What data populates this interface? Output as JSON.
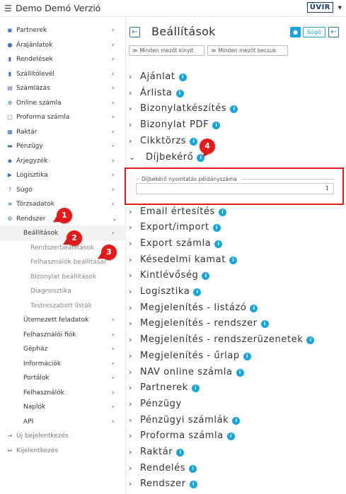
{
  "header": {
    "menu_icon": "hamburger-icon",
    "title": "Demo Demó Verzió",
    "logo_text": "ÜVIR"
  },
  "sidebar": {
    "items": [
      {
        "label": "Partnerek",
        "icon": "id-card-icon",
        "chevron": true
      },
      {
        "label": "Árajánlatok",
        "icon": "users-icon",
        "chevron": true
      },
      {
        "label": "Rendelések",
        "icon": "file-icon",
        "chevron": true
      },
      {
        "label": "Szállítólevél",
        "icon": "file-icon",
        "chevron": true
      },
      {
        "label": "Számlázás",
        "icon": "file-text-icon",
        "chevron": true
      },
      {
        "label": "Online számla",
        "icon": "globe-icon",
        "chevron": true
      },
      {
        "label": "Proforma számla",
        "icon": "note-icon",
        "chevron": true
      },
      {
        "label": "Raktár",
        "icon": "warehouse-icon",
        "chevron": true
      },
      {
        "label": "Pénzügy",
        "icon": "money-icon",
        "chevron": true
      },
      {
        "label": "Árjegyzék",
        "icon": "tag-icon",
        "chevron": true
      },
      {
        "label": "Logisztika",
        "icon": "truck-icon",
        "chevron": true
      },
      {
        "label": "Súgó",
        "icon": "question-icon",
        "chevron": true
      },
      {
        "label": "Törzsadatok",
        "icon": "database-icon",
        "chevron": true
      },
      {
        "label": "Rendszer",
        "icon": "gears-icon",
        "chevron": "down"
      },
      {
        "label": "Beállítások",
        "level": 1,
        "chevron": true,
        "active": true
      },
      {
        "label": "Rendszerbeállítások",
        "level": 2
      },
      {
        "label": "Felhasználók beállításai",
        "level": 2
      },
      {
        "label": "Bizonylat beállítások",
        "level": 2
      },
      {
        "label": "Diagnosztika",
        "level": 2
      },
      {
        "label": "Testreszabott listák",
        "level": 2
      },
      {
        "label": "Ütemezett feladatok",
        "level": 1,
        "chevron": true
      },
      {
        "label": "Felhasználói fiók",
        "level": 1,
        "chevron": true
      },
      {
        "label": "Gépház",
        "level": 1,
        "chevron": true
      },
      {
        "label": "Információk",
        "level": 1,
        "chevron": true
      },
      {
        "label": "Portálok",
        "level": 1,
        "chevron": true
      },
      {
        "label": "Felhasználók",
        "level": 1,
        "chevron": true
      },
      {
        "label": "Naplók",
        "level": 1,
        "chevron": true
      },
      {
        "label": "API",
        "level": 1,
        "chevron": true
      },
      {
        "label": "Új bejelentkezés",
        "icon": "login-icon",
        "muted": true
      },
      {
        "label": "Kijelentkezés",
        "icon": "logout-icon",
        "muted": true
      }
    ]
  },
  "annotations": [
    "1",
    "2",
    "3",
    "4"
  ],
  "main": {
    "title": "Beállítások",
    "help_label": "Súgó",
    "expand_all": "Minden mezőt kinyit",
    "collapse_all": "Minden mezőt becsuk",
    "sections": [
      {
        "label": "Ajánlat",
        "info": true
      },
      {
        "label": "Árlista",
        "info": true
      },
      {
        "label": "Bizonylatkészítés",
        "info": true
      },
      {
        "label": "Bizonylat PDF",
        "info": true
      },
      {
        "label": "Cikktörzs",
        "info": true
      },
      {
        "label": "Díjbekérő",
        "info": true,
        "expanded": true
      },
      {
        "label": "Email értesítés",
        "info": true
      },
      {
        "label": "Export/import",
        "info": true
      },
      {
        "label": "Export számla",
        "info": true
      },
      {
        "label": "Késedelmi kamat",
        "info": true
      },
      {
        "label": "Kintlévőség",
        "info": true
      },
      {
        "label": "Logisztika",
        "info": true
      },
      {
        "label": "Megjelenítés - listázó",
        "info": true
      },
      {
        "label": "Megjelenítés - rendszer",
        "info": true
      },
      {
        "label": "Megjelenítés - rendszerüzenetek",
        "info": true
      },
      {
        "label": "Megjelenítés - űrlap",
        "info": true
      },
      {
        "label": "NAV online számla",
        "info": true
      },
      {
        "label": "Partnerek",
        "info": true
      },
      {
        "label": "Pénzügy",
        "info": false
      },
      {
        "label": "Pénzügyi számlák",
        "info": true
      },
      {
        "label": "Proforma számla",
        "info": true
      },
      {
        "label": "Raktár",
        "info": true
      },
      {
        "label": "Rendelés",
        "info": true
      },
      {
        "label": "Rendszer",
        "info": true
      }
    ],
    "dijbekero_field": {
      "legend": "Díjbekérő nyomtatás példányszáma",
      "value": "1"
    }
  },
  "colors": {
    "accent": "#1aa3d9",
    "annotation": "#e21b1b",
    "link": "#2d6da3"
  }
}
